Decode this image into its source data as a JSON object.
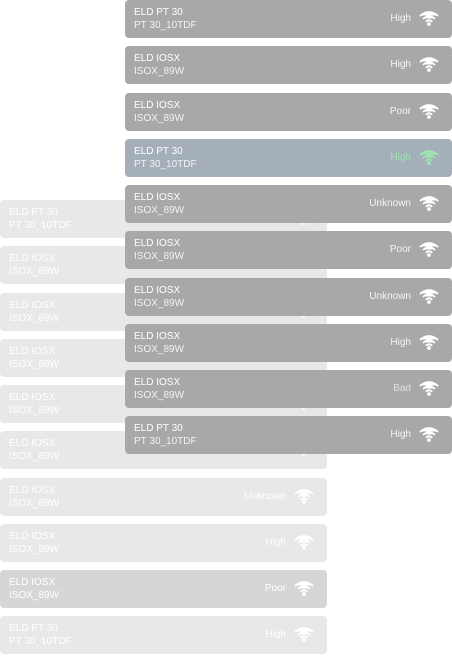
{
  "back_list": [
    {
      "name": "ELD PT 30",
      "model": "PT 30_10TDF",
      "status": "",
      "marker": true
    },
    {
      "name": "ELD IOSX",
      "model": "ISOX_89W",
      "status": "",
      "marker": false
    },
    {
      "name": "ELD IOSX",
      "model": "ISOX_89W",
      "status": "",
      "marker": true
    },
    {
      "name": "ELD IOSX",
      "model": "ISOX_89W",
      "status": "",
      "marker": false
    },
    {
      "name": "ELD IOSX",
      "model": "ISOX_89W",
      "status": "",
      "marker": true
    },
    {
      "name": "ELD IOSX",
      "model": "ISOX_89W",
      "status": "",
      "marker": true
    },
    {
      "name": "ELD IOSX",
      "model": "ISOX_89W",
      "status": "Unknown",
      "marker": false
    },
    {
      "name": "ELD IOSX",
      "model": "ISOX_89W",
      "status": "High",
      "marker": false
    },
    {
      "name": "ELD IOSX",
      "model": "ISOX_89W",
      "status": "Poor",
      "marker": false
    },
    {
      "name": "ELD PT 30",
      "model": "PT 30_10TDF",
      "status": "High",
      "marker": false
    }
  ],
  "front_list": [
    {
      "name": "ELD PT 30",
      "model": "PT 30_10TDF",
      "status": "High",
      "selected": false
    },
    {
      "name": "ELD IOSX",
      "model": "ISOX_89W",
      "status": "High",
      "selected": false
    },
    {
      "name": "ELD IOSX",
      "model": "ISOX_89W",
      "status": "Poor",
      "selected": false
    },
    {
      "name": "ELD PT 30",
      "model": "PT 30_10TDF",
      "status": "High",
      "selected": true
    },
    {
      "name": "ELD IOSX",
      "model": "ISOX_89W",
      "status": "Unknown",
      "selected": false
    },
    {
      "name": "ELD IOSX",
      "model": "ISOX_89W",
      "status": "Poor",
      "selected": false
    },
    {
      "name": "ELD IOSX",
      "model": "ISOX_89W",
      "status": "Unknown",
      "selected": false
    },
    {
      "name": "ELD IOSX",
      "model": "ISOX_89W",
      "status": "High",
      "selected": false
    },
    {
      "name": "ELD IOSX",
      "model": "ISOX_89W",
      "status": "Bad",
      "selected": false
    },
    {
      "name": "ELD PT 30",
      "model": "PT 30_10TDF",
      "status": "High",
      "selected": false
    }
  ],
  "icons": {
    "signal": "wifi-signal-icon"
  },
  "colors": {
    "selected_accent": "#9fe3b4",
    "card_front": "#a8a8a8",
    "card_selected": "#a5afb9",
    "card_back": "#e8e8e8"
  }
}
